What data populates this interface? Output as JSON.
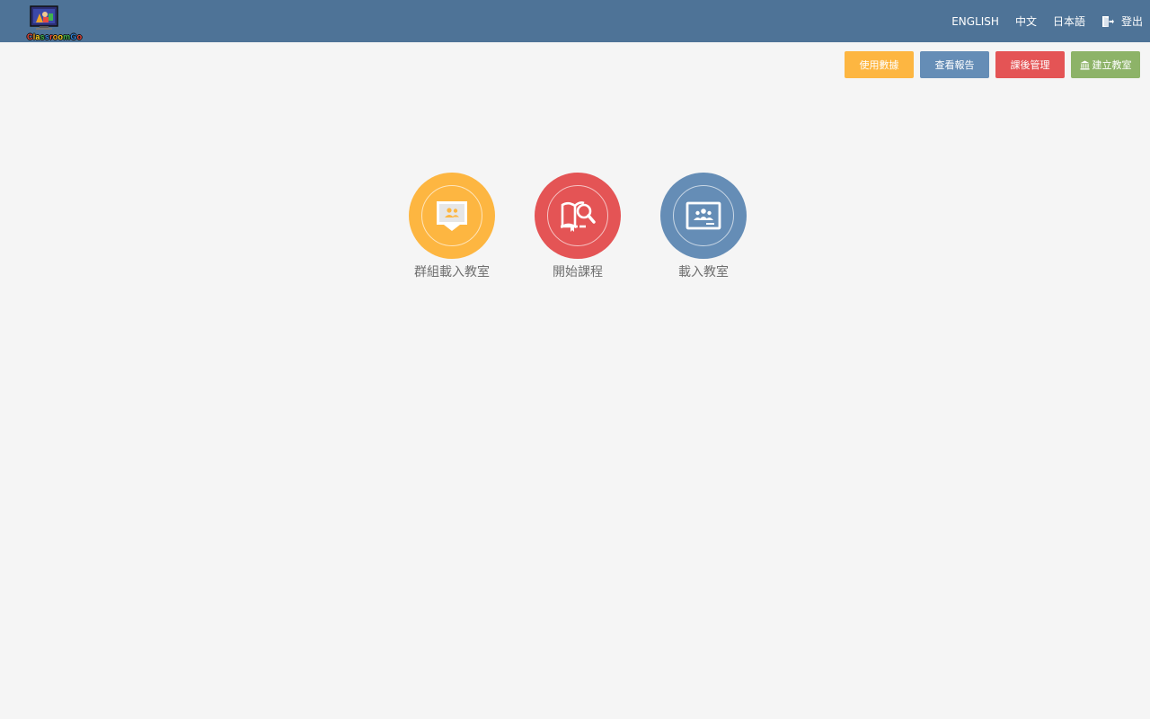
{
  "app": {
    "logo_text": "ClassroomGo"
  },
  "nav": {
    "items": [
      {
        "label": "ENGLISH"
      },
      {
        "label": "中文"
      },
      {
        "label": "日本語"
      }
    ],
    "logout_label": "登出",
    "logout_icon": "logout-door-icon"
  },
  "actions": {
    "buttons": [
      {
        "label": "使用數據",
        "color": "#fdb641"
      },
      {
        "label": "查看報告",
        "color": "#658db6"
      },
      {
        "label": "課後管理",
        "color": "#e45455"
      },
      {
        "label": "建立教室",
        "color": "#8db368",
        "icon": "institution-icon"
      }
    ]
  },
  "tiles": [
    {
      "label": "群組載入教室",
      "color": "#fdb641",
      "icon": "group-presentation-icon"
    },
    {
      "label": "開始課程",
      "color": "#e45455",
      "icon": "book-search-icon"
    },
    {
      "label": "載入教室",
      "color": "#658db6",
      "icon": "classroom-board-icon"
    }
  ],
  "colors": {
    "header": "#4e7397",
    "background": "#f5f5f5"
  }
}
